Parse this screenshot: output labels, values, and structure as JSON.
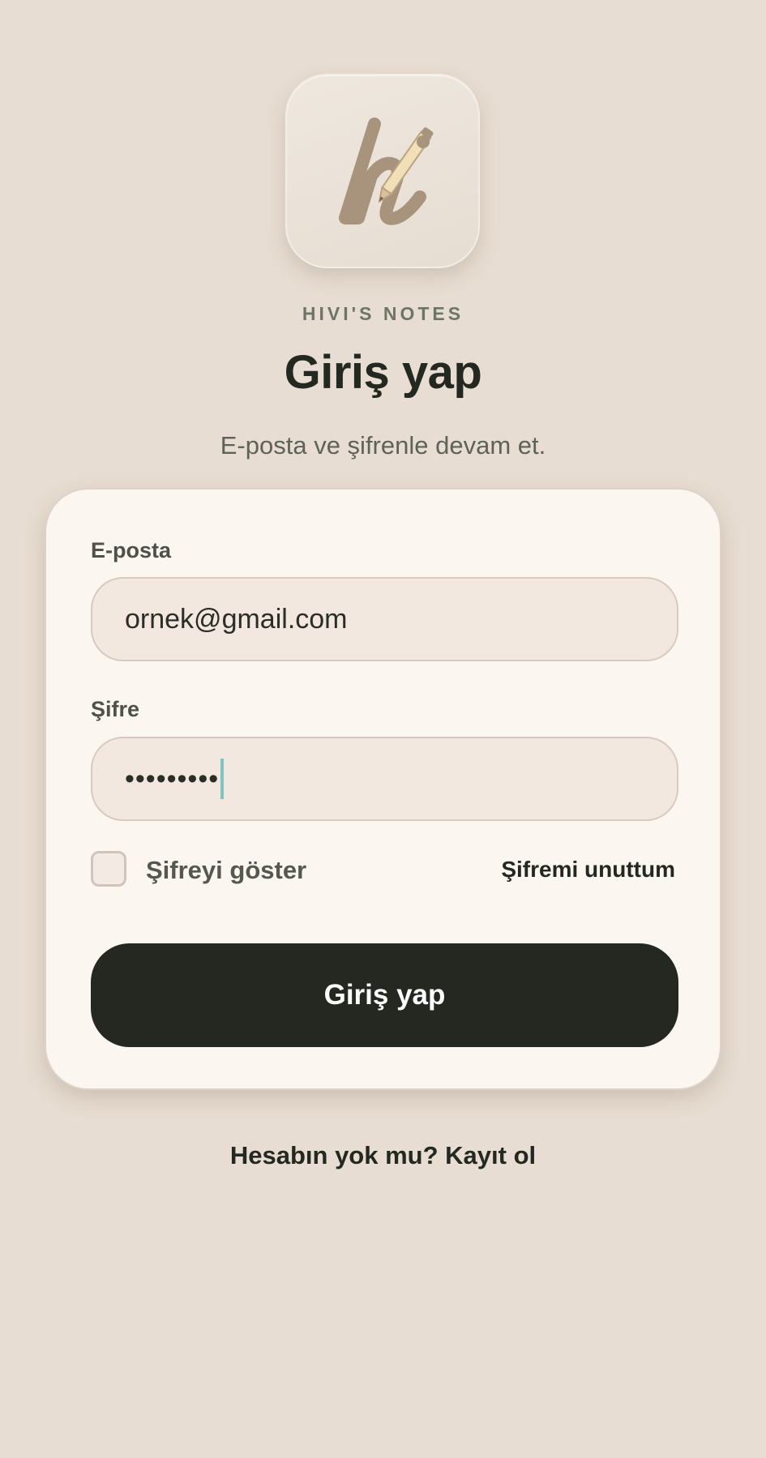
{
  "app": {
    "brand_name": "HIVI'S NOTES",
    "logo_icon": "handwritten-h-pencil-logo"
  },
  "header": {
    "title": "Giriş yap",
    "subtitle": "E-posta ve şifrenle devam et."
  },
  "form": {
    "email_label": "E-posta",
    "email_value": "ornek@gmail.com",
    "password_label": "Şifre",
    "password_masked": "•••••••••",
    "show_password_label": "Şifreyi göster",
    "show_password_checked": false,
    "forgot_password_label": "Şifremi unuttum",
    "submit_label": "Giriş yap"
  },
  "footer": {
    "signup_prompt": "Hesabın yok mu? Kayıt ol"
  },
  "colors": {
    "background": "#e8ddd2",
    "card": "#fcf6f1",
    "input_fill": "#f3e8df",
    "primary_button": "#242820",
    "caret": "#7fc4c0"
  }
}
